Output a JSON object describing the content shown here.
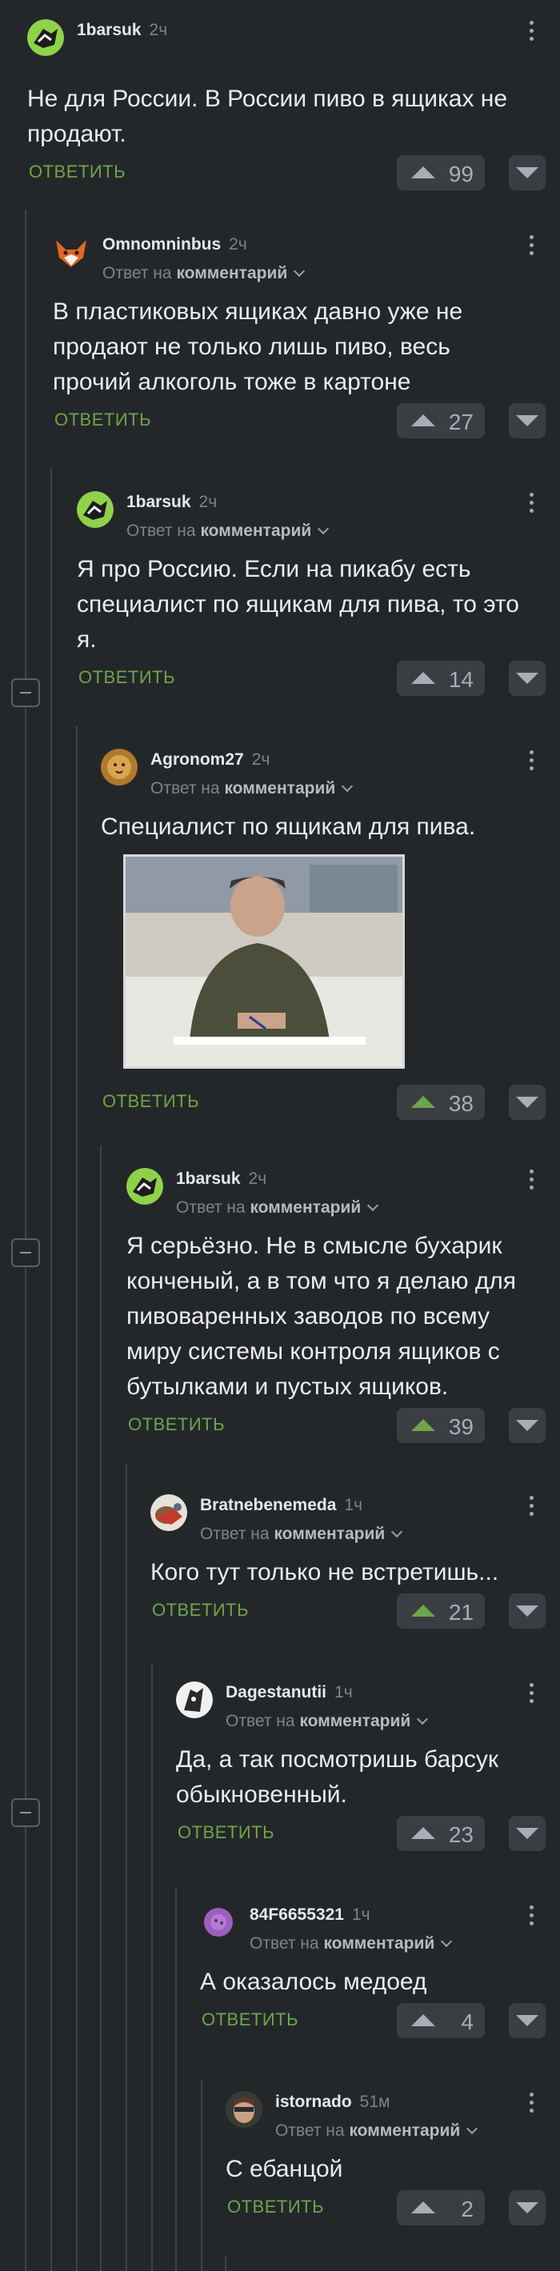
{
  "reply_label": "ОТВЕТИТЬ",
  "reply_prefix": "Ответ на",
  "reply_target": "комментарий",
  "colors": {
    "background": "#24272a",
    "accent_green": "#6ea54a",
    "muted": "#7d848a"
  },
  "comments": [
    {
      "author": "1barsuk",
      "time": "2ч",
      "text": "Не для России. В России пиво в ящиках не продают.",
      "score": "99",
      "reply_to": false,
      "upvoted": false,
      "avatar": "badger-avatar"
    },
    {
      "author": "Omnomninbus",
      "time": "2ч",
      "text": "В пластиковых ящиках давно уже не продают не только лишь пиво, весь прочий алкоголь тоже в картоне",
      "score": "27",
      "reply_to": true,
      "upvoted": false,
      "avatar": "fox-avatar"
    },
    {
      "author": "1barsuk",
      "time": "2ч",
      "text": "Я про Россию. Если на пикабу есть специалист по ящикам для пива, то это я.",
      "score": "14",
      "reply_to": true,
      "upvoted": false,
      "avatar": "badger-avatar"
    },
    {
      "author": "Agronom27",
      "time": "2ч",
      "text": "Специалист по ящикам для пива.",
      "score": "38",
      "reply_to": true,
      "upvoted": true,
      "avatar": "lion-avatar",
      "has_image": true
    },
    {
      "author": "1barsuk",
      "time": "2ч",
      "text": "Я серьёзно. Не в смысле бухарик конченый, а в том что я делаю для пивоваренных заводов по всему миру системы контроля ящиков с бутылками и пустых ящиков.",
      "score": "39",
      "reply_to": true,
      "upvoted": true,
      "avatar": "badger-avatar"
    },
    {
      "author": "Bratnebenemeda",
      "time": "1ч",
      "text": "Кого тут только не встретишь...",
      "score": "21",
      "reply_to": true,
      "upvoted": true,
      "avatar": "bear-avatar"
    },
    {
      "author": "Dagestanutii",
      "time": "1ч",
      "text": "Да, а так посмотришь барсук обыкновенный.",
      "score": "23",
      "reply_to": true,
      "upvoted": false,
      "avatar": "bw-avatar"
    },
    {
      "author": "84F6655321",
      "time": "1ч",
      "text": "А оказалось медоед",
      "score": "4",
      "reply_to": true,
      "upvoted": false,
      "avatar": "purple-avatar"
    },
    {
      "author": "istornado",
      "time": "51м",
      "text": "С ебанцой",
      "score": "2",
      "reply_to": true,
      "upvoted": false,
      "avatar": "face-avatar"
    }
  ]
}
